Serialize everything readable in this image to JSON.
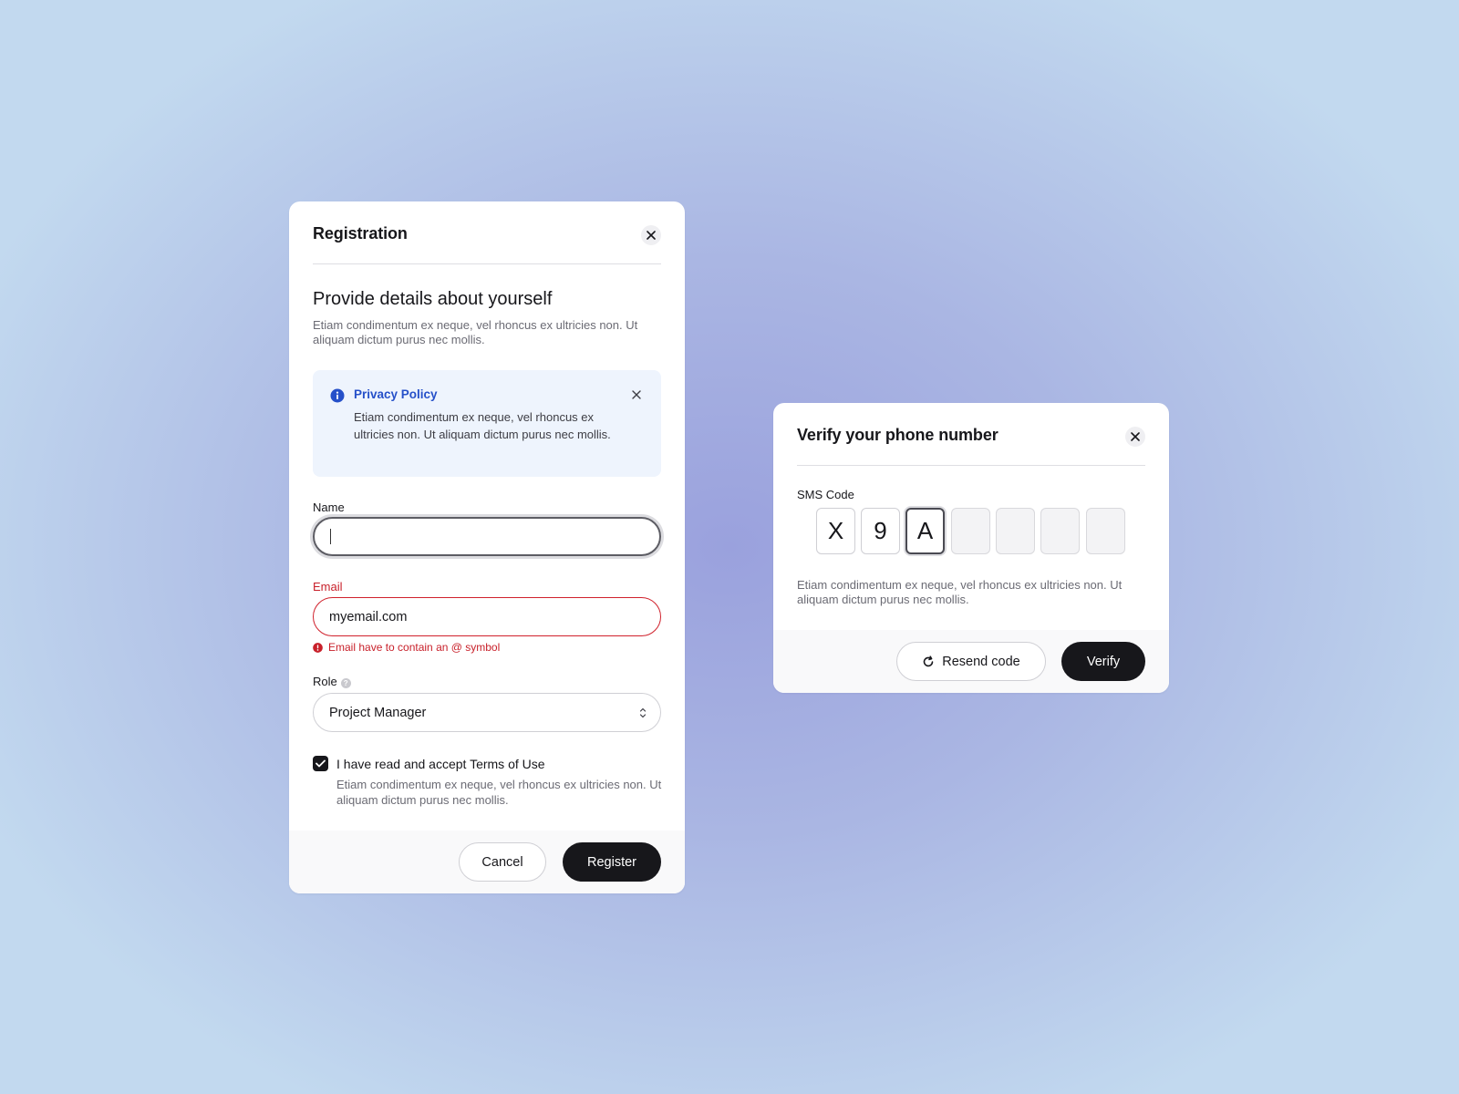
{
  "registration": {
    "title": "Registration",
    "heading": "Provide details about yourself",
    "description": "Etiam condimentum ex neque, vel rhoncus ex ultricies non. Ut aliquam dictum purus nec mollis.",
    "alert": {
      "title": "Privacy Policy",
      "text": "Etiam condimentum ex neque, vel rhoncus ex ultricies non. Ut aliquam dictum purus nec mollis."
    },
    "name": {
      "label": "Name",
      "value": ""
    },
    "email": {
      "label": "Email",
      "value": "myemail.com",
      "error": "Email have to contain an @ symbol"
    },
    "role": {
      "label": "Role",
      "value": "Project Manager"
    },
    "terms": {
      "checked": true,
      "label": "I have read and accept Terms of Use",
      "description": "Etiam condimentum ex neque, vel rhoncus ex ultricies non. Ut aliquam dictum purus nec mollis."
    },
    "buttons": {
      "cancel": "Cancel",
      "register": "Register"
    }
  },
  "verify": {
    "title": "Verify your phone number",
    "sms_label": "SMS Code",
    "code": [
      "X",
      "9",
      "A",
      "",
      "",
      "",
      ""
    ],
    "description": "Etiam condimentum ex neque, vel rhoncus ex ultricies non. Ut aliquam dictum purus nec mollis.",
    "buttons": {
      "resend": "Resend code",
      "verify": "Verify"
    }
  },
  "colors": {
    "accent_dark": "#17171b",
    "error": "#c8202a",
    "info": "#2550c9",
    "alert_bg": "#eef4fd"
  },
  "icons": {
    "close": "close-icon",
    "info": "info-icon",
    "error": "error-icon",
    "help": "help-icon",
    "chevron": "chevron-updown-icon",
    "check": "check-icon",
    "refresh": "refresh-icon"
  }
}
